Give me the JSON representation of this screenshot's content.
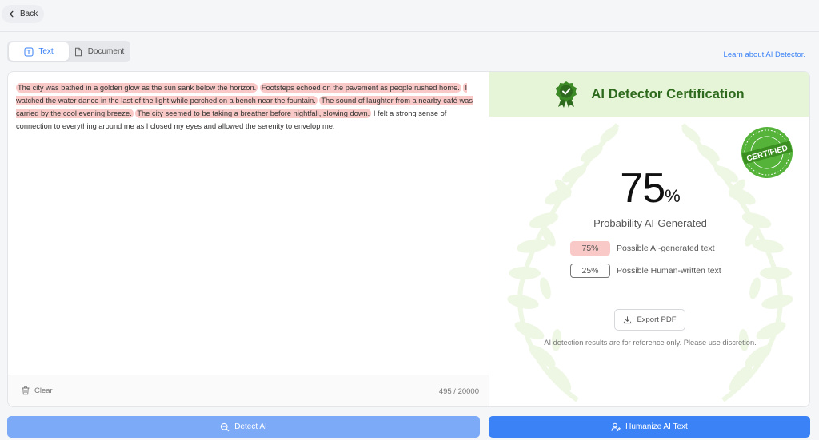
{
  "topbar": {
    "back_label": "Back"
  },
  "tabs": [
    {
      "label": "Text",
      "active": true
    },
    {
      "label": "Document",
      "active": false
    }
  ],
  "learn_link": "Learn about AI Detector.",
  "editor": {
    "segments": [
      {
        "text": "The city was bathed in a golden glow as the sun sank below the horizon.",
        "ai": true
      },
      {
        "text": "Footsteps echoed on the pavement as people rushed home.",
        "ai": true
      },
      {
        "text": "I watched the water dance in the last of the light while perched on a bench near the fountain.",
        "ai": true
      },
      {
        "text": "The sound of laughter from a nearby café was carried by the cool evening breeze.",
        "ai": true
      },
      {
        "text": "The city seemed to be taking a breather before nightfall, slowing down.",
        "ai": true
      },
      {
        "text": "I felt a strong sense of connection to everything around me as I closed my eyes and allowed the serenity to envelop me.",
        "ai": false
      }
    ],
    "clear_label": "Clear",
    "char_count": "495 / 20000"
  },
  "certification": {
    "title": "AI Detector Certification",
    "seal_text": "CERTIFIED",
    "percent_value": "75",
    "percent_sign": "%",
    "probability_label": "Probability AI-Generated",
    "ai_percent": "75%",
    "ai_label": "Possible AI-generated text",
    "human_percent": "25%",
    "human_label": "Possible Human-written text",
    "export_label": "Export PDF",
    "disclaimer": "AI detection results are for reference only. Please use discretion."
  },
  "actions": {
    "detect_label": "Detect AI",
    "humanize_label": "Humanize AI Text"
  },
  "colors": {
    "accent": "#3b82f6",
    "detect_button": "#7daaf7",
    "highlight": "#f8c9c7",
    "cert_header": "#e6f4d7",
    "cert_title": "#2e6a1d",
    "seal_green": "#4caf2f"
  }
}
